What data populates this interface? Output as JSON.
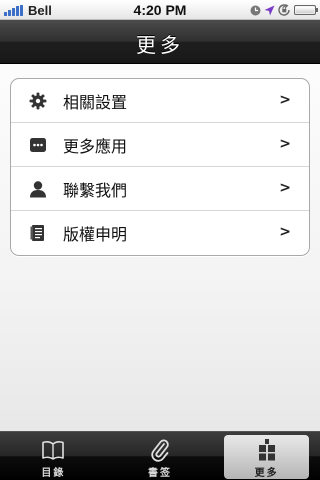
{
  "status_bar": {
    "carrier": "Bell",
    "time": "4:20 PM",
    "icons": [
      "signal-bars-icon",
      "clock-icon",
      "location-arrow-icon",
      "rotation-lock-icon",
      "battery-icon"
    ]
  },
  "nav": {
    "title": "更多"
  },
  "menu": {
    "items": [
      {
        "label": "相關設置",
        "icon": "gear-icon",
        "chevron": ">"
      },
      {
        "label": "更多應用",
        "icon": "more-apps-icon",
        "chevron": ">"
      },
      {
        "label": "聯繫我們",
        "icon": "person-icon",
        "chevron": ">"
      },
      {
        "label": "版權申明",
        "icon": "document-icon",
        "chevron": ">"
      }
    ]
  },
  "tabbar": {
    "tabs": [
      {
        "label": "目錄",
        "icon": "open-book-icon",
        "selected": false
      },
      {
        "label": "書签",
        "icon": "paperclip-icon",
        "selected": false
      },
      {
        "label": "更多",
        "icon": "more-grid-icon",
        "selected": true
      }
    ]
  },
  "colors": {
    "nav_bar": "#1e1e1e",
    "tab_bar": "#000000",
    "list_border": "#a9a9a9",
    "signal_blue": "#3a6ec7",
    "location_purple": "#7a3cc7"
  }
}
